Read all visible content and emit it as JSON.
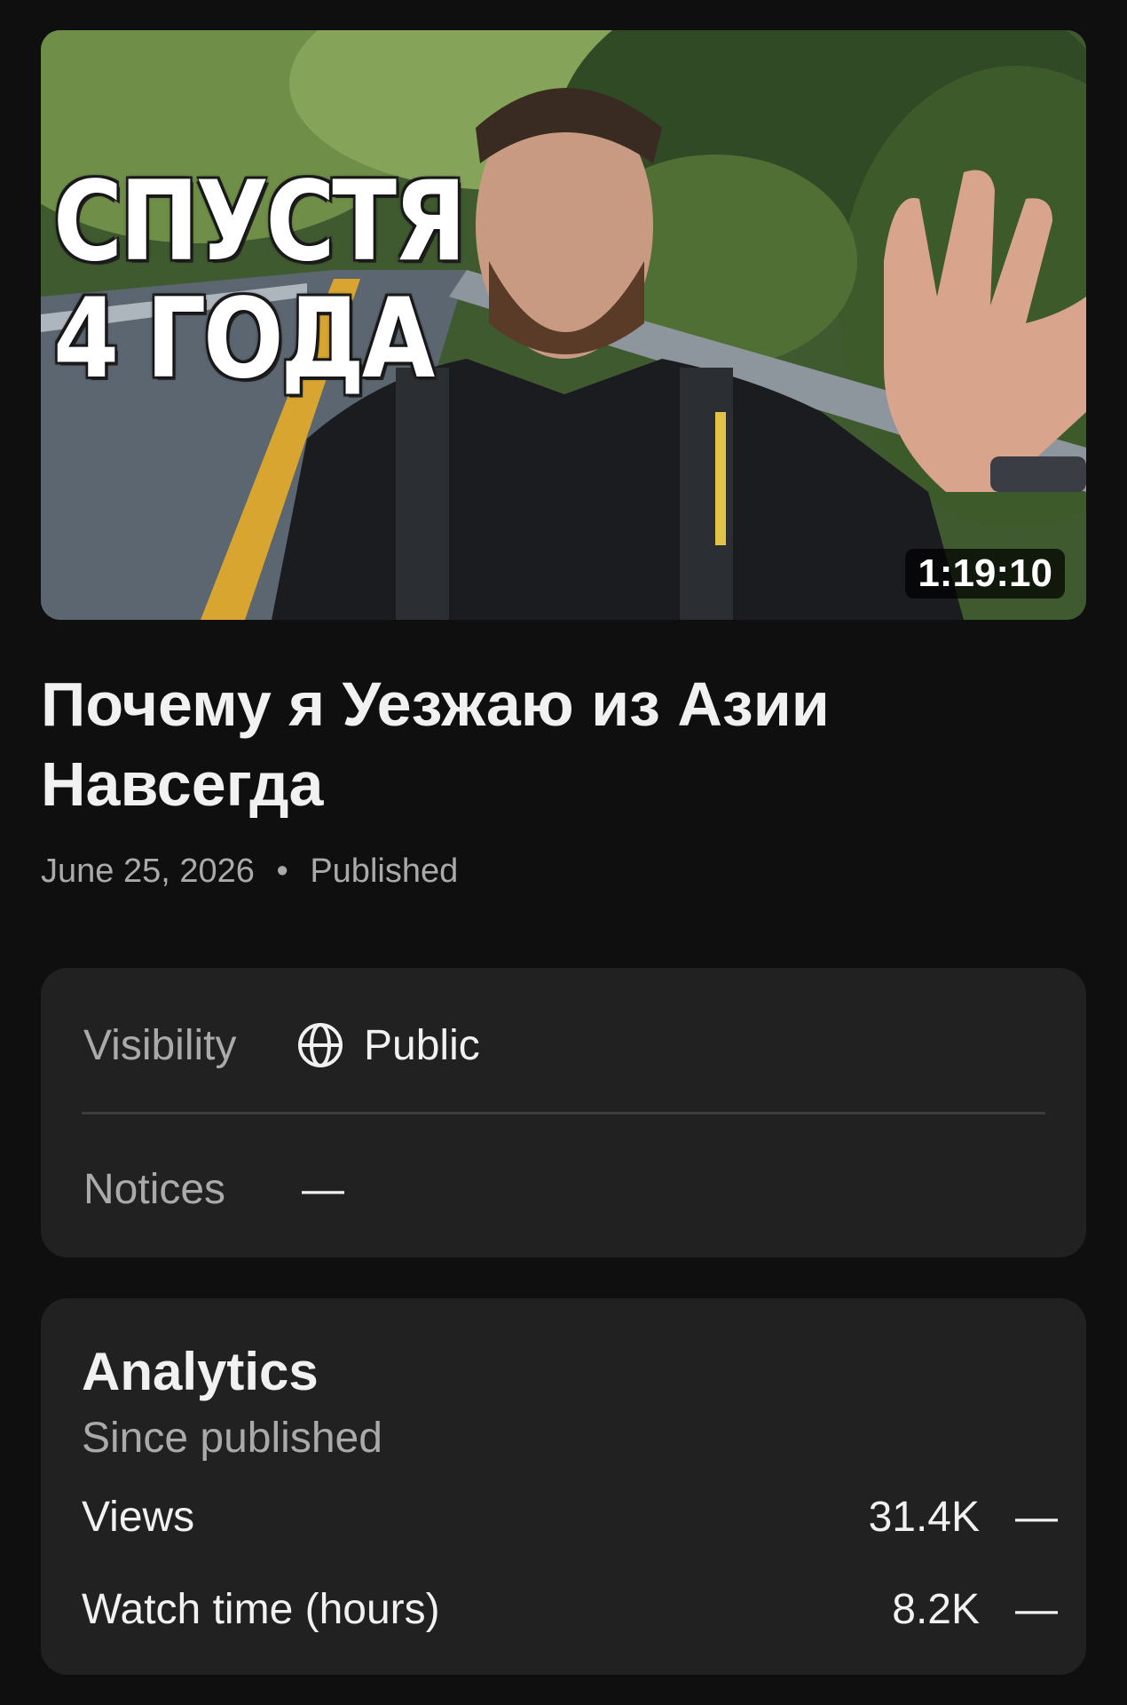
{
  "video": {
    "thumbnail_text": [
      "СПУСТЯ",
      "4 ГОДА"
    ],
    "duration": "1:19:10",
    "title": "Почему я Уезжаю из Азии Навсегда",
    "date": "June 25, 2026",
    "separator": "•",
    "status": "Published"
  },
  "details": {
    "visibility_label": "Visibility",
    "visibility_icon": "globe-icon",
    "visibility_value": "Public",
    "notices_label": "Notices",
    "notices_value": "—"
  },
  "analytics": {
    "title": "Analytics",
    "subtitle": "Since published",
    "metrics": [
      {
        "label": "Views",
        "value": "31.4K",
        "trend": "—"
      },
      {
        "label": "Watch time (hours)",
        "value": "8.2K",
        "trend": "—"
      }
    ]
  }
}
